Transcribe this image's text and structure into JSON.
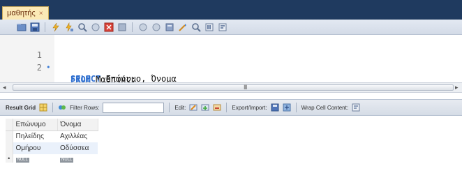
{
  "tab": {
    "title": "μαθητής",
    "close": "×"
  },
  "editor": {
    "lines": [
      {
        "number": "1",
        "marker": "•",
        "keyword": "SELECT",
        "rest": " Επώνυμο, Όνομα"
      },
      {
        "number": "2",
        "marker": "",
        "keyword": "FROM",
        "rest": " Μαθητής;"
      }
    ]
  },
  "scrollbar": {
    "grip": "III"
  },
  "result_toolbar": {
    "result_grid": "Result Grid",
    "filter_rows": "Filter Rows:",
    "filter_value": "",
    "edit": "Edit:",
    "export_import": "Export/Import:",
    "wrap_cell": "Wrap Cell Content:"
  },
  "grid": {
    "columns": [
      "Επώνυμο",
      "Όνομα"
    ],
    "rows": [
      [
        "Πηλείδης",
        "Αχιλλέας"
      ],
      [
        "Ομήρου",
        "Οδύσσεα"
      ]
    ],
    "null_row": [
      "NULL",
      "NULL"
    ],
    "new_row_marker": "•"
  },
  "colors": {
    "keyword": "#2f6fcf",
    "tab_bg": "#fbe9b6",
    "window_bar": "#1f3a5f"
  }
}
